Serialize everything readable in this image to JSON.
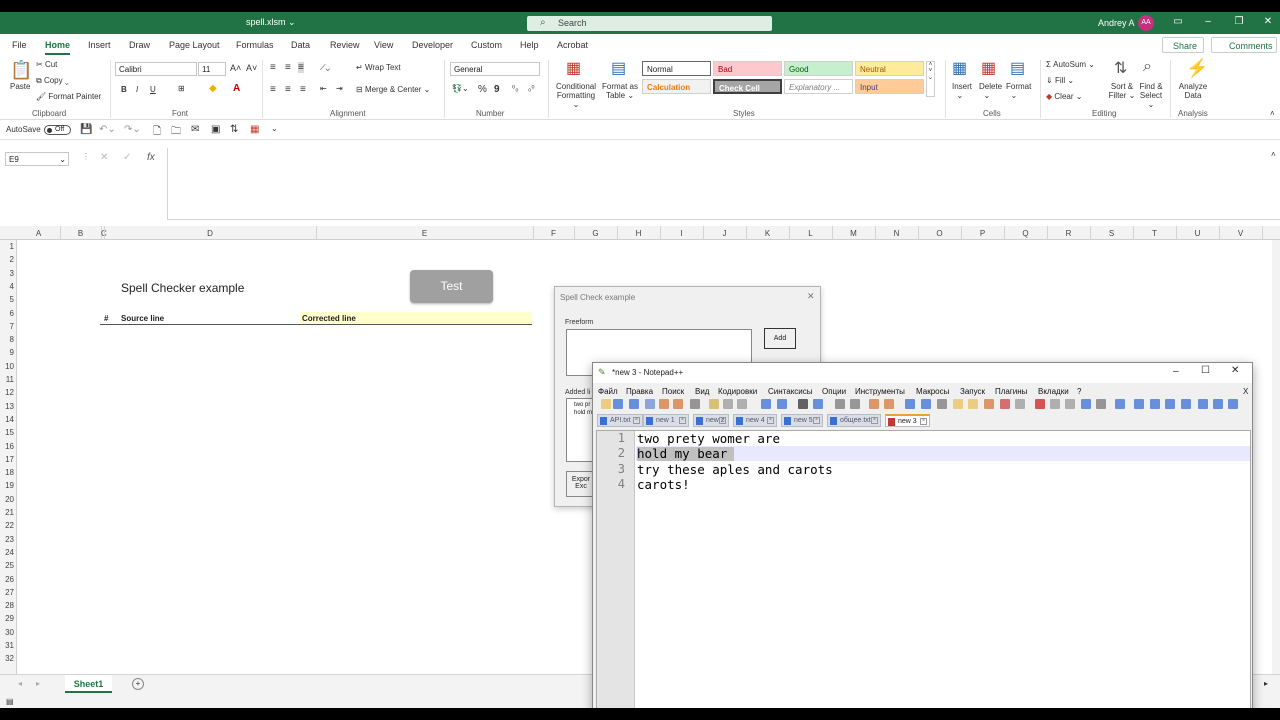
{
  "excel": {
    "file_title": "spell.xlsm",
    "search_placeholder": "Search",
    "user_name": "Andrey A",
    "user_initials": "AA",
    "menu_tabs": [
      "File",
      "Home",
      "Insert",
      "Draw",
      "Page Layout",
      "Formulas",
      "Data",
      "Review",
      "View",
      "Developer",
      "Custom",
      "Help",
      "Acrobat"
    ],
    "active_tab": "Home",
    "share_label": "Share",
    "comments_label": "Comments",
    "ribbon": {
      "paste": "Paste",
      "cut": "Cut",
      "copy": "Copy",
      "format_painter": "Format Painter",
      "clipboard": "Clipboard",
      "font_name": "Calibri",
      "font_size": "11",
      "font": "Font",
      "bold": "B",
      "italic": "I",
      "underline": "U",
      "wrap_text": "Wrap Text",
      "merge_center": "Merge & Center",
      "alignment": "Alignment",
      "number_format": "General",
      "number": "Number",
      "percent": "%",
      "comma": "9",
      "conditional_formatting_1": "Conditional",
      "conditional_formatting_2": "Formatting",
      "format_as_table_1": "Format as",
      "format_as_table_2": "Table",
      "styles": "Styles",
      "style_normal": "Normal",
      "style_bad": "Bad",
      "style_good": "Good",
      "style_neutral": "Neutral",
      "style_calculation": "Calculation",
      "style_check_cell": "Check Cell",
      "style_explanatory": "Explanatory ...",
      "style_input": "Input",
      "insert": "Insert",
      "delete": "Delete",
      "format": "Format",
      "cells": "Cells",
      "autosum": "AutoSum",
      "fill": "Fill",
      "clear": "Clear",
      "sort_filter_1": "Sort &",
      "sort_filter_2": "Filter",
      "find_select_1": "Find &",
      "find_select_2": "Select",
      "editing": "Editing",
      "analyze_data_1": "Analyze",
      "analyze_data_2": "Data",
      "analysis": "Analysis"
    },
    "autosave_label": "AutoSave",
    "autosave_state": "Off",
    "name_box": "E9",
    "fx": "fx",
    "columns": [
      "A",
      "B",
      "C",
      "D",
      "E",
      "F",
      "G",
      "H",
      "I",
      "J",
      "K",
      "L",
      "M",
      "N",
      "O",
      "P",
      "Q",
      "R",
      "S",
      "T",
      "U",
      "V"
    ],
    "rows": [
      "1",
      "2",
      "3",
      "4",
      "5",
      "6",
      "7",
      "8",
      "9",
      "10",
      "11",
      "12",
      "13",
      "14",
      "15",
      "16",
      "17",
      "18",
      "19",
      "20",
      "21",
      "22",
      "23",
      "24",
      "25",
      "26",
      "27",
      "28",
      "29",
      "30",
      "31",
      "32"
    ],
    "sheet": {
      "title": "Spell Checker example",
      "test_button": "Test",
      "hdr_num": "#",
      "hdr_source": "Source line",
      "hdr_corrected": "Corrected line"
    },
    "sheet_tab": "Sheet1"
  },
  "vba_dialog": {
    "title": "Spell Check example",
    "freeform_label": "Freeform",
    "add_button": "Add",
    "added_label": "Added li",
    "list_line1": "two pr",
    "list_line2": "hold m",
    "export_1": "Expor",
    "export_2": "Exc"
  },
  "notepad": {
    "title": "*new 3 - Notepad++",
    "menu": [
      "Файл",
      "Правка",
      "Поиск",
      "Вид",
      "Кодировки",
      "Синтаксисы",
      "Опции",
      "Инструменты",
      "Макросы",
      "Запуск",
      "Плагины",
      "Вкладки",
      "?"
    ],
    "close_x": "X",
    "tabs": [
      "API.txt",
      "new 1",
      "new 2",
      "new 4",
      "new 5",
      "общее.txt",
      "new 3"
    ],
    "active_tab": "new 3",
    "lines": [
      {
        "num": "1",
        "text": "two prety womer are"
      },
      {
        "num": "2",
        "text": "hold my bear"
      },
      {
        "num": "3",
        "text": "try these aples and carots"
      },
      {
        "num": "4",
        "text": "carots!"
      }
    ]
  },
  "colors": {
    "excel_green": "#217346",
    "avatar": "#c4317c",
    "corrected_fill": "#ffffcc",
    "current_line": "#e8e8ff",
    "selection": "#c0c0c0"
  }
}
